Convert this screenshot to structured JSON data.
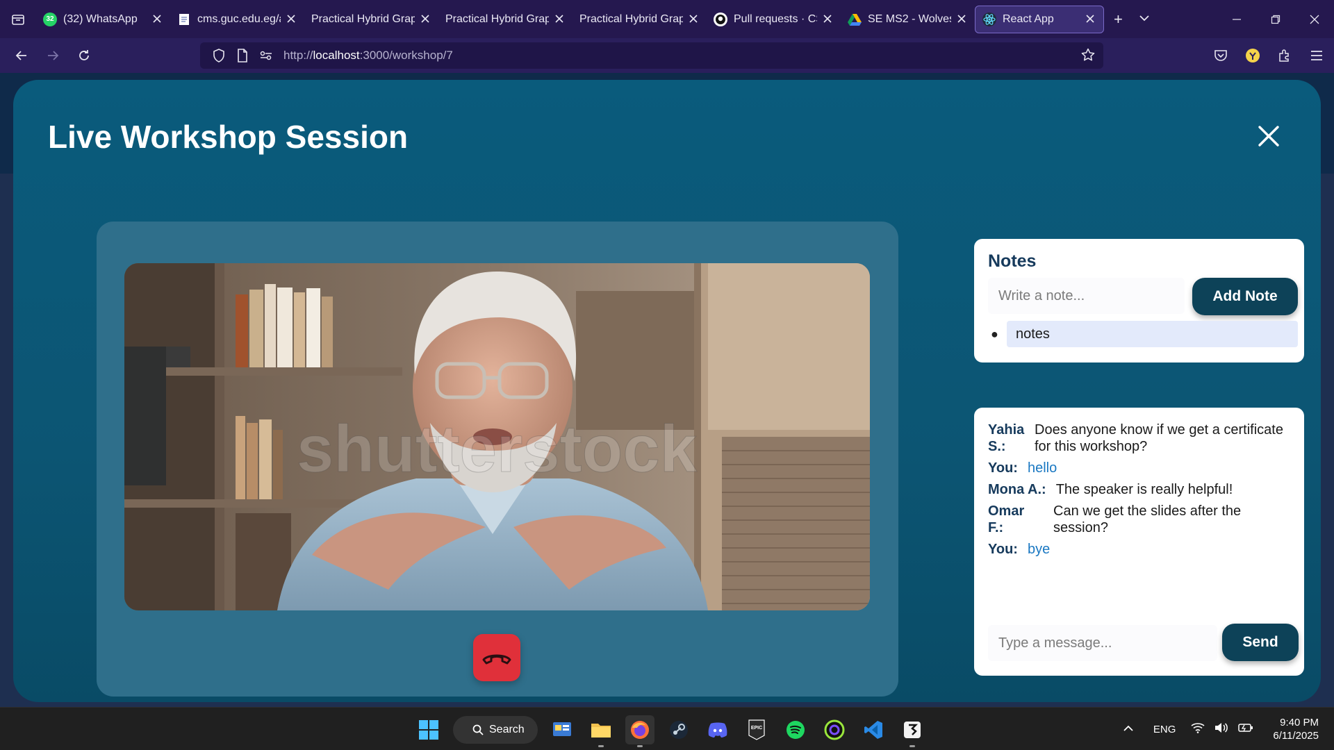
{
  "browser": {
    "tabs": [
      {
        "title": "(32) WhatsApp",
        "badge": "32",
        "favicon": "whatsapp-icon",
        "active": false
      },
      {
        "title": "cms.guc.edu.eg/ap",
        "favicon": "document-icon",
        "active": false
      },
      {
        "title": "Practical Hybrid Graph",
        "favicon": "blank-icon",
        "active": false
      },
      {
        "title": "Practical Hybrid Graph",
        "favicon": "blank-icon",
        "active": false
      },
      {
        "title": "Practical Hybrid Graph",
        "favicon": "blank-icon",
        "active": false
      },
      {
        "title": "Pull requests · CSE",
        "favicon": "github-icon",
        "active": false
      },
      {
        "title": "SE MS2 - Wolves",
        "favicon": "google-drive-icon",
        "active": false
      },
      {
        "title": "React App",
        "favicon": "react-icon",
        "active": true
      }
    ],
    "url": {
      "prefix": "http://",
      "host": "localhost",
      "rest": ":3000/workshop/7"
    }
  },
  "page": {
    "title": "Live Workshop Session",
    "notes": {
      "title": "Notes",
      "input_placeholder": "Write a note...",
      "add_button": "Add Note",
      "items": [
        "notes"
      ]
    },
    "chat": {
      "messages": [
        {
          "sender": "Yahia S.:",
          "text": "Does anyone know if we get a certificate for this workshop?",
          "mine": false
        },
        {
          "sender": "You:",
          "text": "hello",
          "mine": true
        },
        {
          "sender": "Mona A.:",
          "text": "The speaker is really helpful!",
          "mine": false
        },
        {
          "sender": "Omar F.:",
          "text": "Can we get the slides after the session?",
          "mine": false
        },
        {
          "sender": "You:",
          "text": "bye",
          "mine": true
        }
      ],
      "input_placeholder": "Type a message...",
      "send_button": "Send"
    },
    "video": {
      "watermark": "shutterstock"
    }
  },
  "taskbar": {
    "search_label": "Search",
    "language": "ENG",
    "time": "9:40 PM",
    "date": "6/11/2025"
  },
  "colors": {
    "modal_bg": "#0a5b7c",
    "panel_bg": "#2f6f8b",
    "button_dark": "#0d4258",
    "hangup_red": "#e0303a",
    "chat_mine": "#1a78c2"
  }
}
